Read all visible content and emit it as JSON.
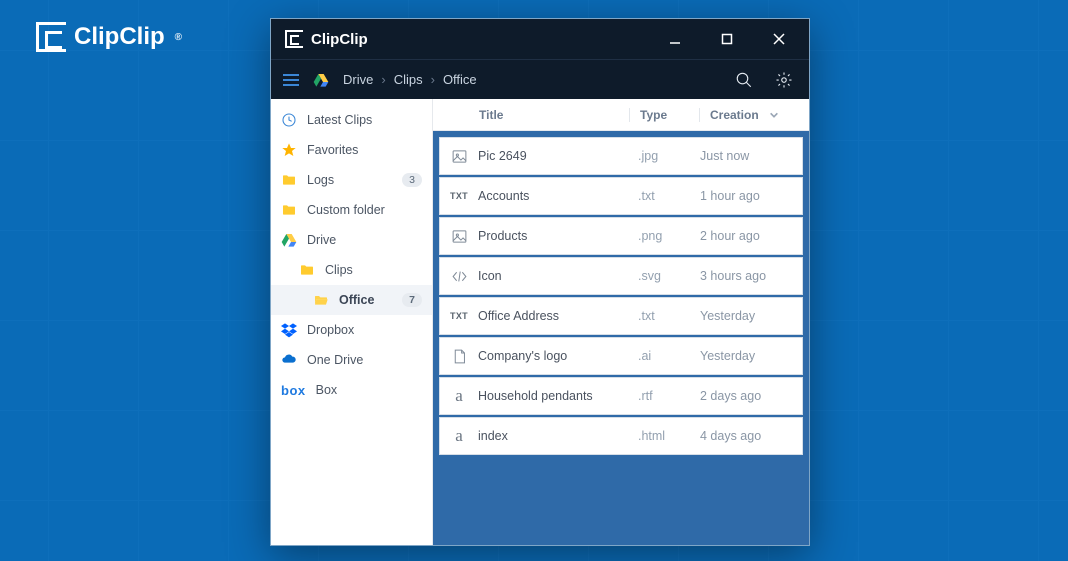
{
  "brand": {
    "label": "ClipClip",
    "registered": "®"
  },
  "titlebar": {
    "title": "ClipClip"
  },
  "breadcrumb": {
    "segments": [
      "Drive",
      "Clips",
      "Office"
    ],
    "sep": "›"
  },
  "sidebar": {
    "items": [
      {
        "name": "latest-clips",
        "label": "Latest Clips",
        "icon": "clock",
        "indent": 0
      },
      {
        "name": "favorites",
        "label": "Favorites",
        "icon": "star",
        "indent": 0
      },
      {
        "name": "logs",
        "label": "Logs",
        "icon": "folder",
        "indent": 0,
        "badge": "3"
      },
      {
        "name": "custom-folder",
        "label": "Custom folder",
        "icon": "folder",
        "indent": 0
      },
      {
        "name": "drive",
        "label": "Drive",
        "icon": "drive",
        "indent": 0
      },
      {
        "name": "clips",
        "label": "Clips",
        "icon": "folder",
        "indent": 1
      },
      {
        "name": "office",
        "label": "Office",
        "icon": "folder-open",
        "indent": 2,
        "badge": "7",
        "active": true
      },
      {
        "name": "dropbox",
        "label": "Dropbox",
        "icon": "dropbox",
        "indent": 0
      },
      {
        "name": "onedrive",
        "label": "One Drive",
        "icon": "onedrive",
        "indent": 0
      },
      {
        "name": "box",
        "label": "Box",
        "icon": "box-text",
        "indent": 0
      }
    ]
  },
  "columns": {
    "title": "Title",
    "type": "Type",
    "creation": "Creation"
  },
  "rows": [
    {
      "icon": "image",
      "title": "Pic 2649",
      "type": ".jpg",
      "time": "Just now"
    },
    {
      "icon": "txt",
      "title": "Accounts",
      "type": ".txt",
      "time": "1 hour ago"
    },
    {
      "icon": "image",
      "title": "Products",
      "type": ".png",
      "time": "2 hour ago"
    },
    {
      "icon": "code",
      "title": "Icon",
      "type": ".svg",
      "time": "3 hours ago"
    },
    {
      "icon": "txt",
      "title": "Office Address",
      "type": ".txt",
      "time": "Yesterday"
    },
    {
      "icon": "doc",
      "title": "Company's logo",
      "type": ".ai",
      "time": "Yesterday"
    },
    {
      "icon": "serif",
      "title": "Household pendants",
      "type": ".rtf",
      "time": "2 days ago"
    },
    {
      "icon": "serif",
      "title": "index",
      "type": ".html",
      "time": "4 days ago"
    }
  ]
}
